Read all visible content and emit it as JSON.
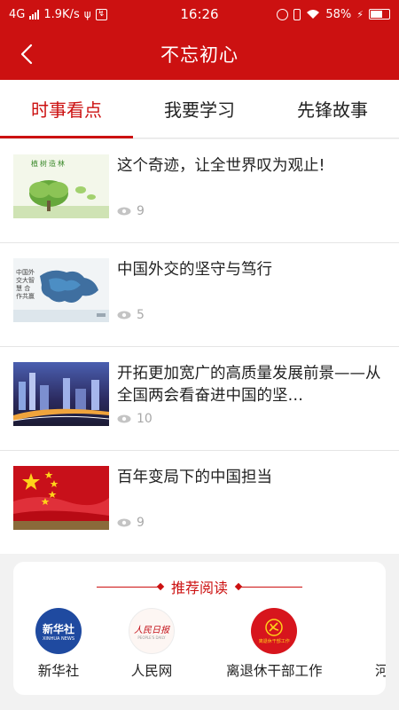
{
  "status": {
    "network": "4G",
    "speed": "1.9K/s",
    "time": "16:26",
    "battery": "58%"
  },
  "header": {
    "title": "不忘初心"
  },
  "tabs": [
    {
      "label": "时事看点",
      "active": true
    },
    {
      "label": "我要学习",
      "active": false
    },
    {
      "label": "先锋故事",
      "active": false
    }
  ],
  "news": [
    {
      "title": "这个奇迹，让全世界叹为观止!",
      "views": "9",
      "thumb_text": "植树造林"
    },
    {
      "title": "中国外交的坚守与笃行",
      "views": "5",
      "thumb_text": "中国外交大智慧 合作共赢"
    },
    {
      "title": "开拓更加宽广的高质量发展前景——从全国两会看奋进中国的坚…",
      "views": "10"
    },
    {
      "title": "百年变局下的中国担当",
      "views": "9"
    }
  ],
  "recommend": {
    "heading": "推荐阅读",
    "items": [
      {
        "label": "新华社",
        "logo_text": "新华社",
        "logo_sub": "XINHUA NEWS"
      },
      {
        "label": "人民网",
        "logo_text": "人民日报",
        "logo_sub": "PEOPLE'S DAILY"
      },
      {
        "label": "离退休干部工作",
        "logo_text": "离退休干部工作"
      },
      {
        "label": "河"
      }
    ]
  },
  "colors": {
    "primary": "#cc1111",
    "text": "#222222",
    "muted": "#a8a8a8",
    "background": "#f2f2f2"
  }
}
